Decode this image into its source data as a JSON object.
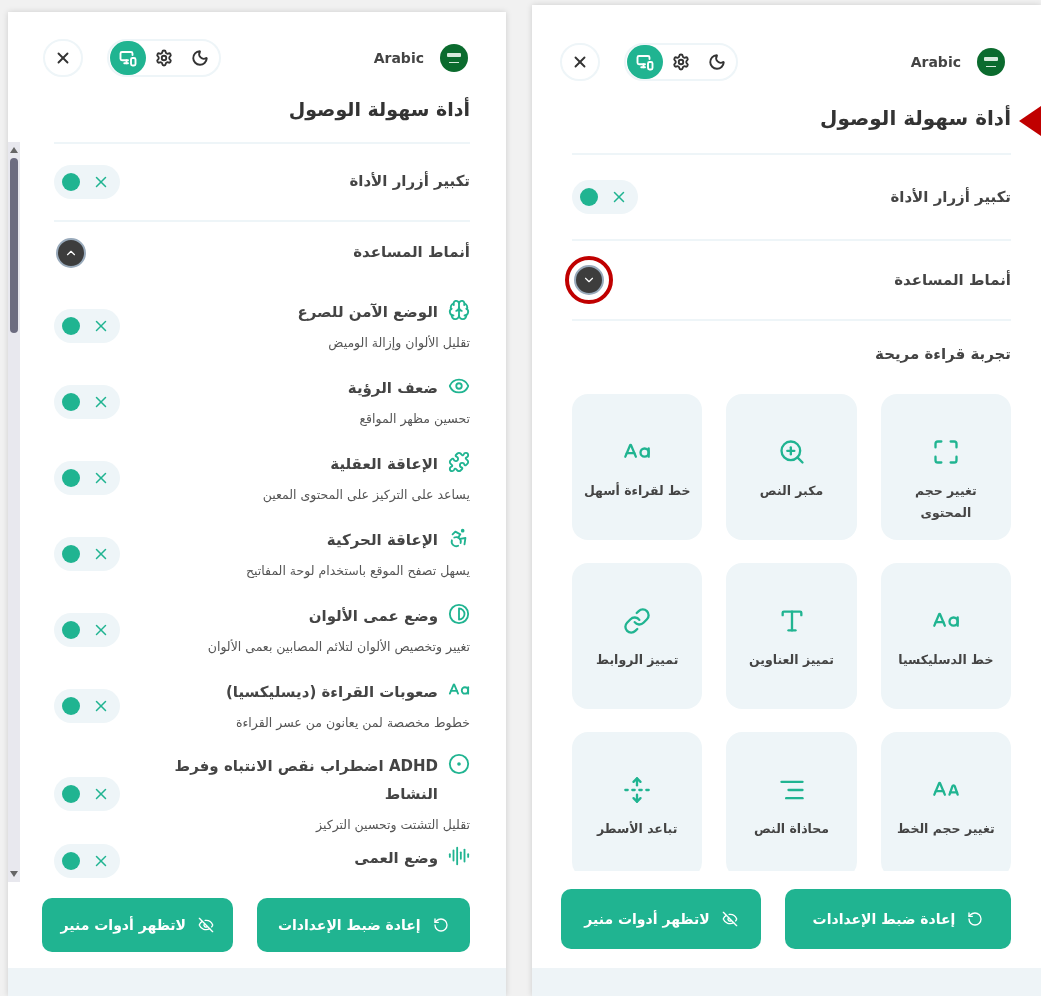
{
  "panels": [
    {
      "language": "Arabic",
      "modes": [
        {
          "selected": true
        },
        {
          "selected": false
        },
        {
          "selected": false
        }
      ],
      "title": "أداة سهولة الوصول",
      "title_pointed": true,
      "toolbar_toggle": {
        "label": "تكبير أزرار الأداة",
        "on": false
      },
      "section": {
        "label": "أنماط المساعدة",
        "expanded": false,
        "circled": true
      },
      "subsection": {
        "title": "تجربة قراءة مريحة",
        "tiles": [
          {
            "label": "تغيير حجم المحتوى"
          },
          {
            "label": "مكبر النص"
          },
          {
            "label": "خط لقراءة أسهل"
          },
          {
            "label": "خط الدسليكسيا"
          },
          {
            "label": "تمييز العناوين"
          },
          {
            "label": "تمييز الروابط"
          },
          {
            "label": "تغيير حجم الخط"
          },
          {
            "label": "محاذاة النص"
          },
          {
            "label": "تباعد الأسطر"
          }
        ]
      },
      "buttons": [
        "إعادة ضبط الإعدادات",
        "لاتظهر أدوات منير"
      ]
    },
    {
      "language": "Arabic",
      "modes": [
        {
          "selected": true
        },
        {
          "selected": false
        },
        {
          "selected": false
        }
      ],
      "title": "أداة سهولة الوصول",
      "title_pointed": false,
      "toolbar_toggle": {
        "label": "تكبير أزرار الأداة",
        "on": false
      },
      "section": {
        "label": "أنماط المساعدة",
        "expanded": true,
        "circled": false
      },
      "profiles": [
        {
          "title": "الوضع الآمن للصرع",
          "description": "تقليل الألوان وإزالة الوميض",
          "on": false
        },
        {
          "title": "ضعف الرؤية",
          "description": "تحسين مظهر المواقع",
          "on": false
        },
        {
          "title": "الإعاقة العقلية",
          "description": "يساعد على التركيز على المحتوى المعين",
          "on": false
        },
        {
          "title": "الإعاقة الحركية",
          "description": "يسهل تصفح الموقع باستخدام لوحة المفاتيح",
          "on": false
        },
        {
          "title": "وضع عمى الألوان",
          "description": "تغيير وتخصيص الألوان لتلائم المصابين بعمى الألوان",
          "on": false
        },
        {
          "title": "صعوبات القراءة (ديسليكسيا)",
          "description": "خطوط مخصصة لمن يعانون من عسر القراءة",
          "on": false
        },
        {
          "title": "ADHD اضطراب نقص الانتباه وفرط النشاط",
          "description": "تقليل التشتت وتحسين التركيز",
          "on": false
        },
        {
          "title": "وضع العمى",
          "on": false
        }
      ],
      "buttons": [
        "إعادة ضبط الإعدادات",
        "لاتظهر أدوات منير"
      ]
    }
  ]
}
